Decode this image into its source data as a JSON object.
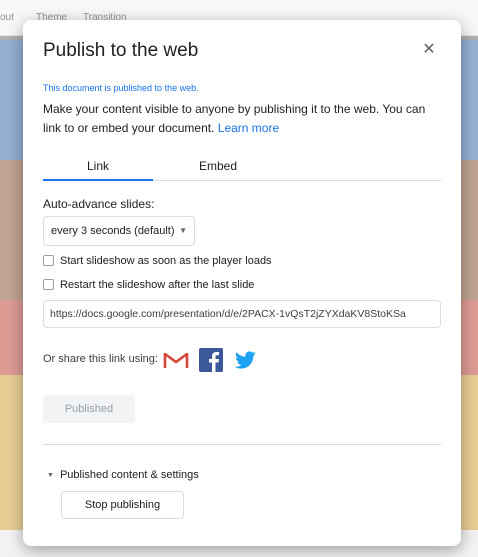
{
  "background": {
    "toolbar_items": [
      "out",
      "Theme",
      "Transition"
    ]
  },
  "dialog": {
    "title": "Publish to the web",
    "close_icon": "close-icon",
    "published_note": "This document is published to the web.",
    "description": "Make your content visible to anyone by publishing it to the web. You can link to or embed your document.",
    "learn_more": "Learn more",
    "tabs": [
      {
        "label": "Link",
        "active": true
      },
      {
        "label": "Embed",
        "active": false
      }
    ],
    "auto_advance": {
      "label": "Auto-advance slides:",
      "selected": "every 3 seconds (default)"
    },
    "options": [
      {
        "label": "Start slideshow as soon as the player loads",
        "checked": false
      },
      {
        "label": "Restart the slideshow after the last slide",
        "checked": false
      }
    ],
    "url": "https://docs.google.com/presentation/d/e/2PACX-1vQsT2jZYXdaKV8StoKSa",
    "share": {
      "label": "Or share this link using:",
      "icons": [
        "gmail-icon",
        "facebook-icon",
        "twitter-icon"
      ]
    },
    "publish_button": "Published",
    "section_label": "Published content & settings",
    "stop_button": "Stop publishing"
  },
  "colors": {
    "accent": "#1a73e8",
    "gmail_red": "#d44638",
    "facebook_blue": "#3b5998",
    "twitter_blue": "#1da1f2"
  }
}
